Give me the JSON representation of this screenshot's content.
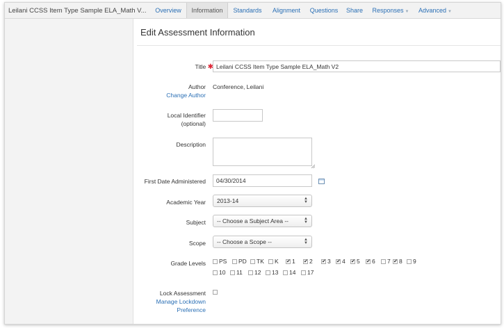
{
  "header": {
    "assessment_title": "Leilani CCSS Item Type Sample ELA_Math V...",
    "tabs": [
      {
        "label": "Overview"
      },
      {
        "label": "Information"
      },
      {
        "label": "Standards"
      },
      {
        "label": "Alignment"
      },
      {
        "label": "Questions"
      },
      {
        "label": "Share"
      },
      {
        "label": "Responses"
      },
      {
        "label": "Advanced"
      }
    ],
    "active_tab": "Information"
  },
  "page": {
    "title": "Edit Assessment Information"
  },
  "form": {
    "title_label": "Title",
    "title_value": "Leilani CCSS Item Type Sample ELA_Math V2",
    "author_label": "Author",
    "author_value": "Conference, Leilani",
    "change_author": "Change Author",
    "local_id_label_1": "Local Identifier",
    "local_id_label_2": "(optional)",
    "local_id_value": "",
    "description_label": "Description",
    "description_value": "",
    "first_date_label": "First Date Administered",
    "first_date_value": "04/30/2014",
    "academic_year_label": "Academic Year",
    "academic_year_value": "2013-14",
    "subject_label": "Subject",
    "subject_value": "-- Choose a Subject Area --",
    "scope_label": "Scope",
    "scope_value": "-- Choose a Scope --",
    "grade_levels_label": "Grade Levels",
    "grades_row1": [
      {
        "label": "PS",
        "checked": false
      },
      {
        "label": "PD",
        "checked": false
      },
      {
        "label": "TK",
        "checked": false
      },
      {
        "label": "K",
        "checked": false
      },
      {
        "label": "1",
        "checked": true
      },
      {
        "label": "2",
        "checked": true
      },
      {
        "label": "3",
        "checked": true
      },
      {
        "label": "4",
        "checked": true
      },
      {
        "label": "5",
        "checked": true
      },
      {
        "label": "6",
        "checked": true
      },
      {
        "label": "7",
        "checked": false
      },
      {
        "label": "8",
        "checked": true
      },
      {
        "label": "9",
        "checked": false
      }
    ],
    "grades_row2": [
      {
        "label": "10",
        "checked": false
      },
      {
        "label": "11",
        "checked": false
      },
      {
        "label": "12",
        "checked": false
      },
      {
        "label": "13",
        "checked": false
      },
      {
        "label": "14",
        "checked": false
      },
      {
        "label": "17",
        "checked": false
      }
    ],
    "lock_label": "Lock Assessment",
    "lock_checked": false,
    "manage_lockdown_1": "Manage Lockdown",
    "manage_lockdown_2": "Preference"
  },
  "colors": {
    "link": "#2a6fb5",
    "required": "#d23333",
    "sidebar": "#f3f3f3"
  }
}
